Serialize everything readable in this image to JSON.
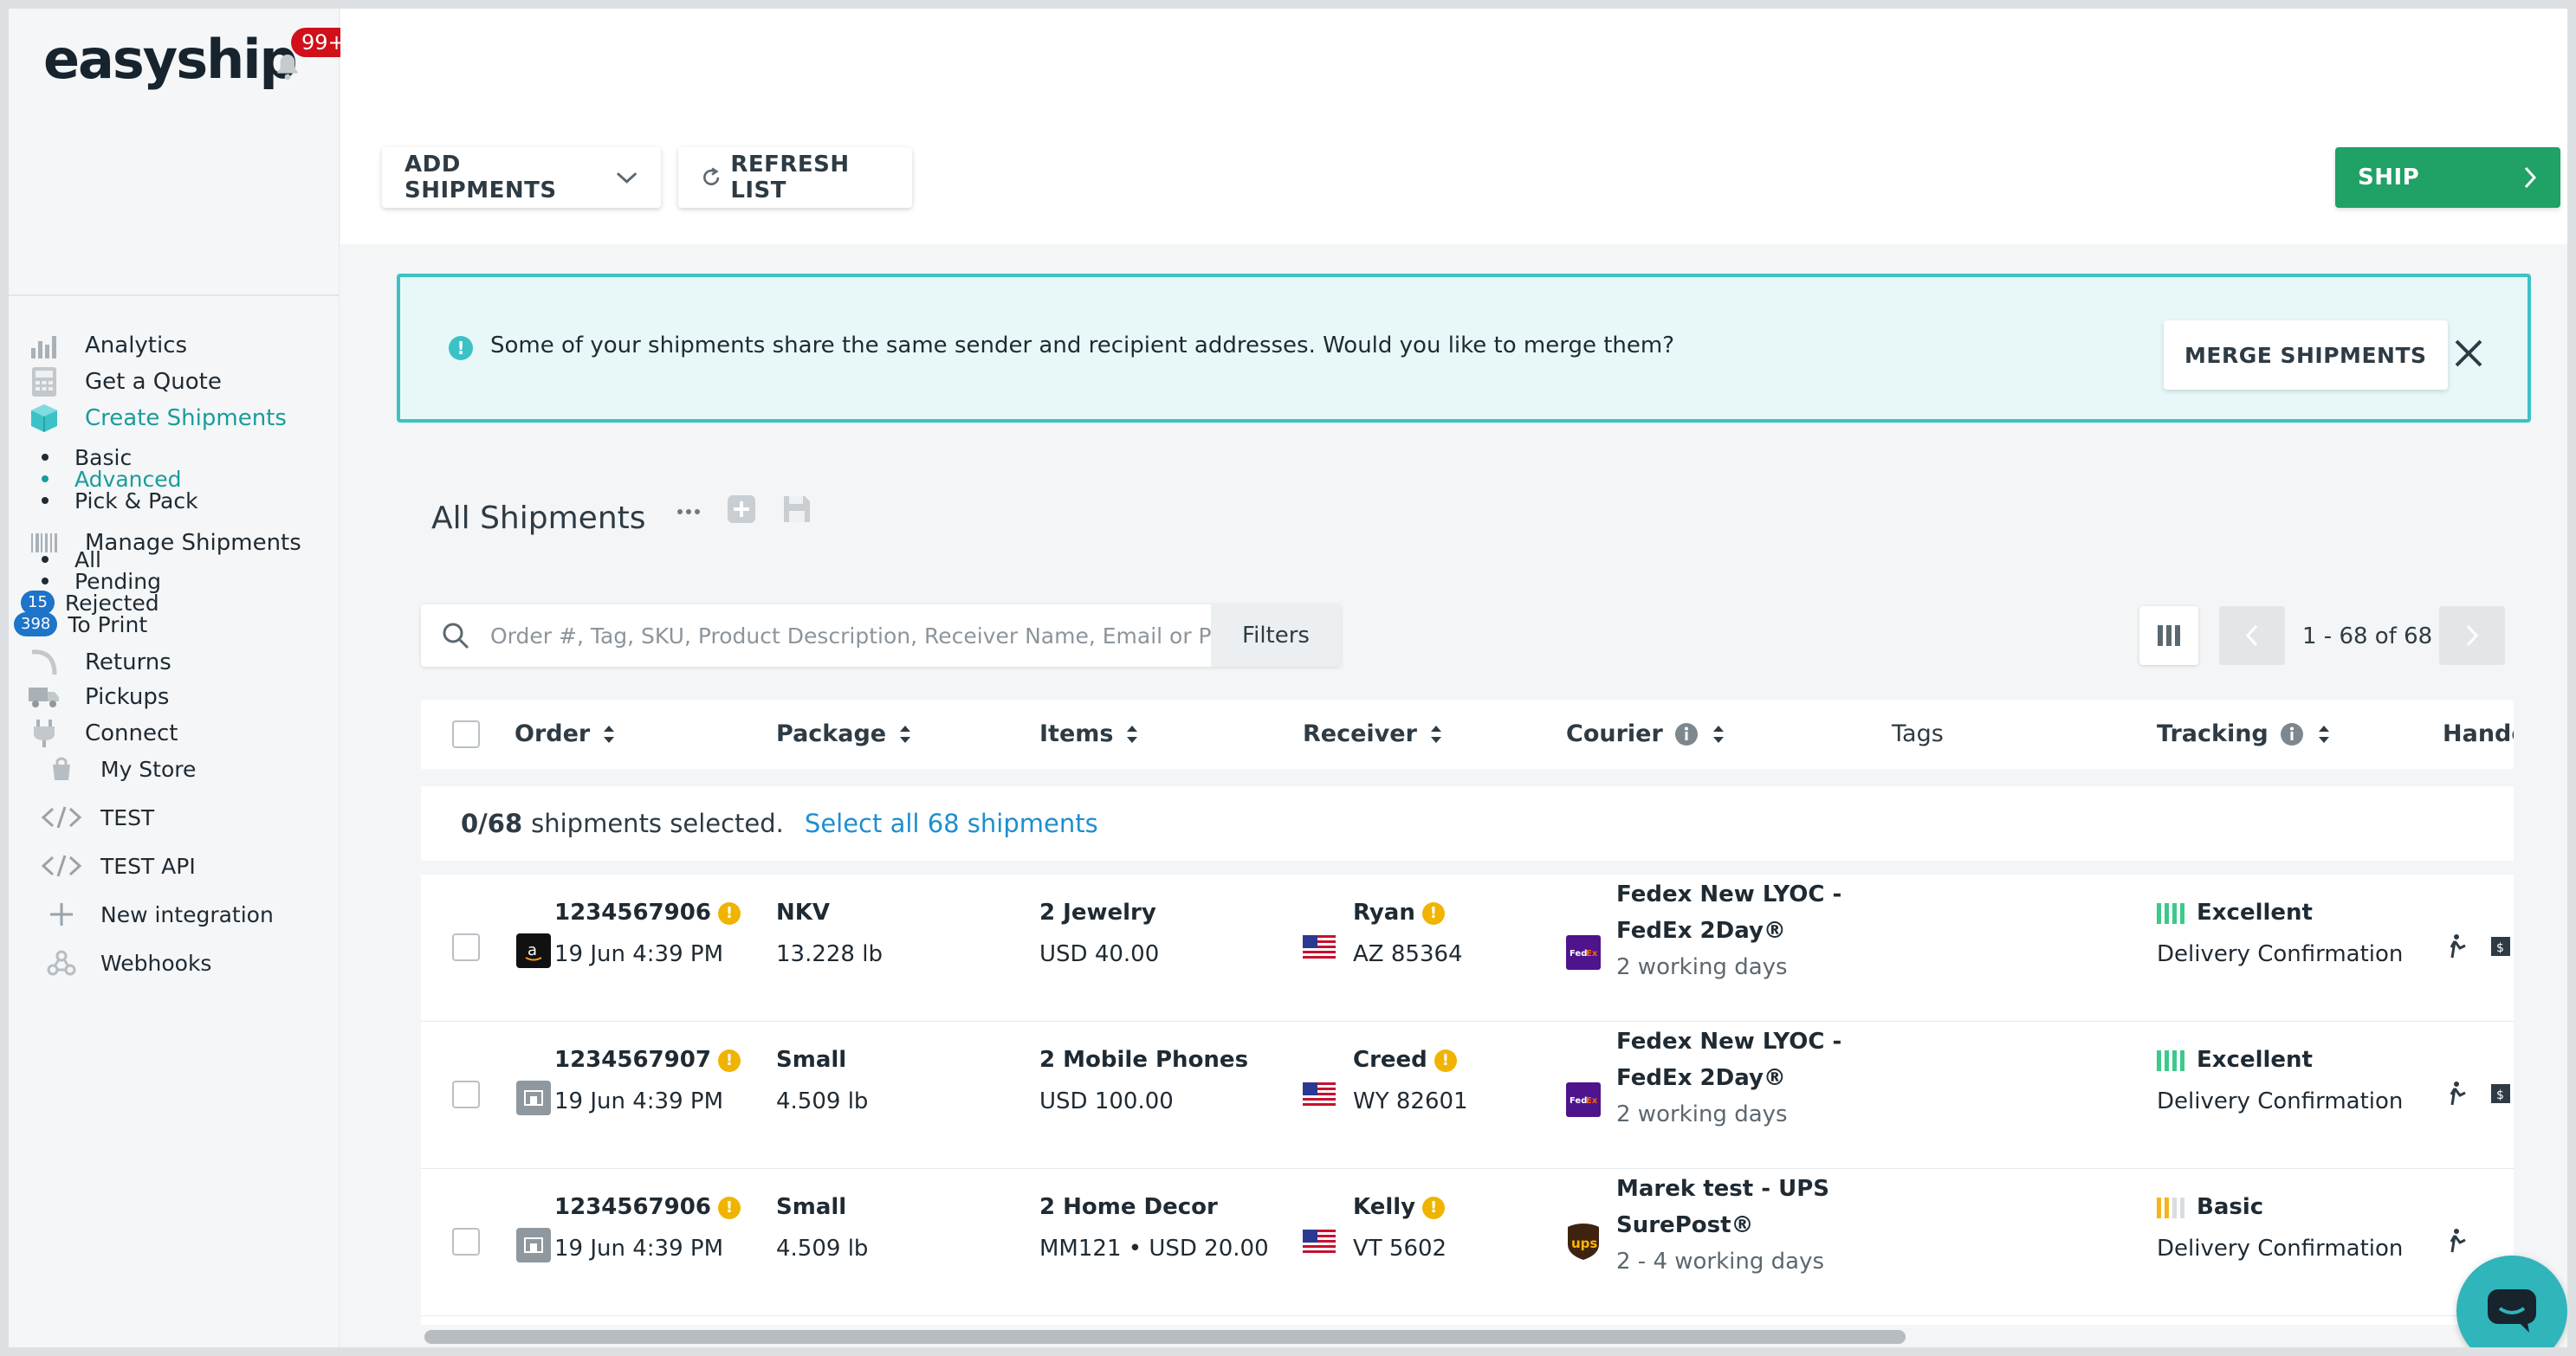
{
  "brand": {
    "name": "easyship",
    "notifications": "99+"
  },
  "sidebar": {
    "nav": [
      {
        "label": "Analytics",
        "icon": "analytics-icon"
      },
      {
        "label": "Get a Quote",
        "icon": "calculator-icon"
      },
      {
        "label": "Create Shipments",
        "icon": "box-icon",
        "active": true
      }
    ],
    "create_sub": [
      {
        "label": "Basic"
      },
      {
        "label": "Advanced",
        "active": true
      },
      {
        "label": "Pick & Pack"
      }
    ],
    "manage": {
      "label": "Manage Shipments",
      "icon": "barcode-icon"
    },
    "manage_sub": [
      {
        "label": "All"
      },
      {
        "label": "Pending"
      },
      {
        "label": "Rejected",
        "count": "15"
      },
      {
        "label": "To Print",
        "count": "398"
      }
    ],
    "returns": "Returns",
    "pickups": "Pickups",
    "connect": "Connect",
    "integrations": [
      {
        "label": "My Store",
        "icon": "store-icon"
      },
      {
        "label": "TEST",
        "icon": "code-icon"
      },
      {
        "label": "TEST API",
        "icon": "code-icon"
      },
      {
        "label": "New integration",
        "icon": "plus-icon"
      },
      {
        "label": "Webhooks",
        "icon": "webhook-icon"
      }
    ]
  },
  "toolbar": {
    "add_shipments": "ADD SHIPMENTS",
    "refresh_list": "REFRESH LIST",
    "ship": "SHIP"
  },
  "alert": {
    "message": "Some of your shipments share the same sender and recipient addresses. Would you like to merge them?",
    "merge_button": "MERGE SHIPMENTS"
  },
  "list": {
    "title": "All Shipments",
    "search_placeholder": "Order #, Tag, SKU, Product Description, Receiver Name, Email or Phone ...",
    "filters": "Filters",
    "pagination": "1 - 68 of 68",
    "columns": {
      "order": "Order",
      "package": "Package",
      "items": "Items",
      "receiver": "Receiver",
      "courier": "Courier",
      "tags": "Tags",
      "tracking": "Tracking",
      "handover": "Hando"
    },
    "selection": {
      "count": "0/68",
      "text": "shipments selected.",
      "select_all": "Select all 68 shipments"
    },
    "rows": [
      {
        "order": "1234567906",
        "date": "19 Jun 4:39 PM",
        "store": "amazon",
        "package": "NKV",
        "weight": "13.228 lb",
        "items": "2 Jewelry",
        "value": "USD 40.00",
        "receiver": "Ryan",
        "location": "AZ 85364",
        "courier_line1": "Fedex New LYOC -",
        "courier_line2": "FedEx 2Day®",
        "delivery": "2 working days",
        "courier_logo": "fedex",
        "tracking": "Excellent",
        "tracking_level": 4,
        "tracking_color": "#3cc98a",
        "tracking_sub": "Delivery Confirmation"
      },
      {
        "order": "1234567907",
        "date": "19 Jun 4:39 PM",
        "store": "store",
        "package": "Small",
        "weight": "4.509 lb",
        "items": "2 Mobile Phones",
        "value": "USD 100.00",
        "receiver": "Creed",
        "location": "WY 82601",
        "courier_line1": "Fedex New LYOC -",
        "courier_line2": "FedEx 2Day®",
        "delivery": "2 working days",
        "courier_logo": "fedex",
        "tracking": "Excellent",
        "tracking_level": 4,
        "tracking_color": "#3cc98a",
        "tracking_sub": "Delivery Confirmation"
      },
      {
        "order": "1234567906",
        "date": "19 Jun 4:39 PM",
        "store": "store",
        "package": "Small",
        "weight": "4.509 lb",
        "items": "2 Home Decor",
        "value": "MM121 • USD 20.00",
        "receiver": "Kelly",
        "location": "VT 5602",
        "courier_line1": "Marek test - UPS",
        "courier_line2": "SurePost®",
        "delivery": "2 - 4 working days",
        "courier_logo": "ups",
        "tracking": "Basic",
        "tracking_level": 2,
        "tracking_color": "#f3b51b",
        "tracking_sub": "Delivery Confirmation"
      }
    ]
  },
  "colors": {
    "accent": "#1a9c9c",
    "ship": "#20a166",
    "alert_border": "#3cc2c6",
    "link": "#1d8fd0"
  }
}
